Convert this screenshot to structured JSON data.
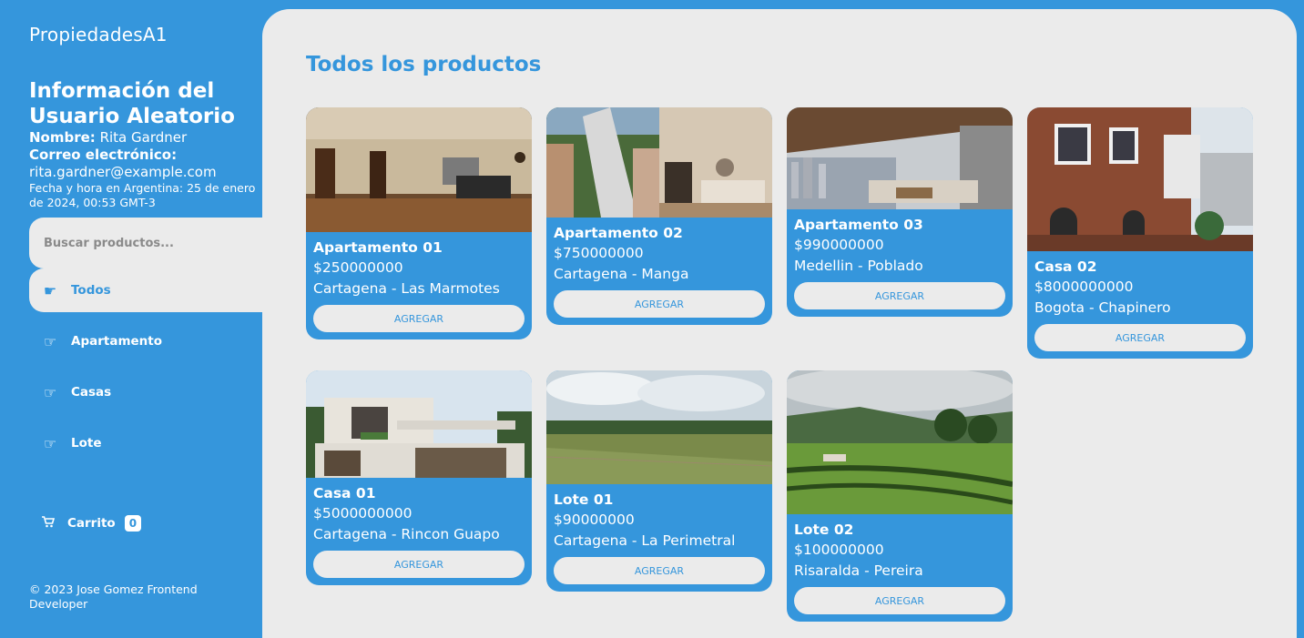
{
  "app": {
    "title": "PropiedadesA1"
  },
  "user": {
    "heading": "Información del Usuario Aleatorio",
    "name_label": "Nombre:",
    "name": "Rita Gardner",
    "email_label": "Correo electrónico:",
    "email": "rita.gardner@example.com",
    "datetime": "Fecha y hora en Argentina: 25 de enero de 2024, 00:53 GMT-3"
  },
  "search": {
    "placeholder": "Buscar productos..."
  },
  "nav": {
    "items": [
      {
        "label": "Todos",
        "icon": "hand-pointing-icon",
        "active": true
      },
      {
        "label": "Apartamento",
        "icon": "hand-pointing-icon",
        "active": false
      },
      {
        "label": "Casas",
        "icon": "hand-pointing-icon",
        "active": false
      },
      {
        "label": "Lote",
        "icon": "hand-pointing-icon",
        "active": false
      }
    ]
  },
  "cart": {
    "label": "Carrito",
    "count": "0",
    "icon": "cart-icon"
  },
  "footer": {
    "text": "© 2023 Jose Gomez Frontend Developer"
  },
  "main": {
    "title": "Todos los productos"
  },
  "products": [
    {
      "name": "Apartamento 01",
      "price": "$250000000",
      "location": "Cartagena - Las Marmotes",
      "button": "AGREGAR"
    },
    {
      "name": "Apartamento 02",
      "price": "$750000000",
      "location": "Cartagena - Manga",
      "button": "AGREGAR"
    },
    {
      "name": "Apartamento 03",
      "price": "$990000000",
      "location": "Medellin - Poblado",
      "button": "AGREGAR"
    },
    {
      "name": "Casa 02",
      "price": "$8000000000",
      "location": "Bogota - Chapinero",
      "button": "AGREGAR"
    },
    {
      "name": "Casa 01",
      "price": "$5000000000",
      "location": "Cartagena - Rincon Guapo",
      "button": "AGREGAR"
    },
    {
      "name": "Lote 01",
      "price": "$90000000",
      "location": "Cartagena - La Perimetral",
      "button": "AGREGAR"
    },
    {
      "name": "Lote 02",
      "price": "$100000000",
      "location": "Risaralda - Pereira",
      "button": "AGREGAR"
    }
  ],
  "colors": {
    "primary": "#3596dc",
    "background": "#ebebeb",
    "text_on_primary": "#ffffff"
  }
}
